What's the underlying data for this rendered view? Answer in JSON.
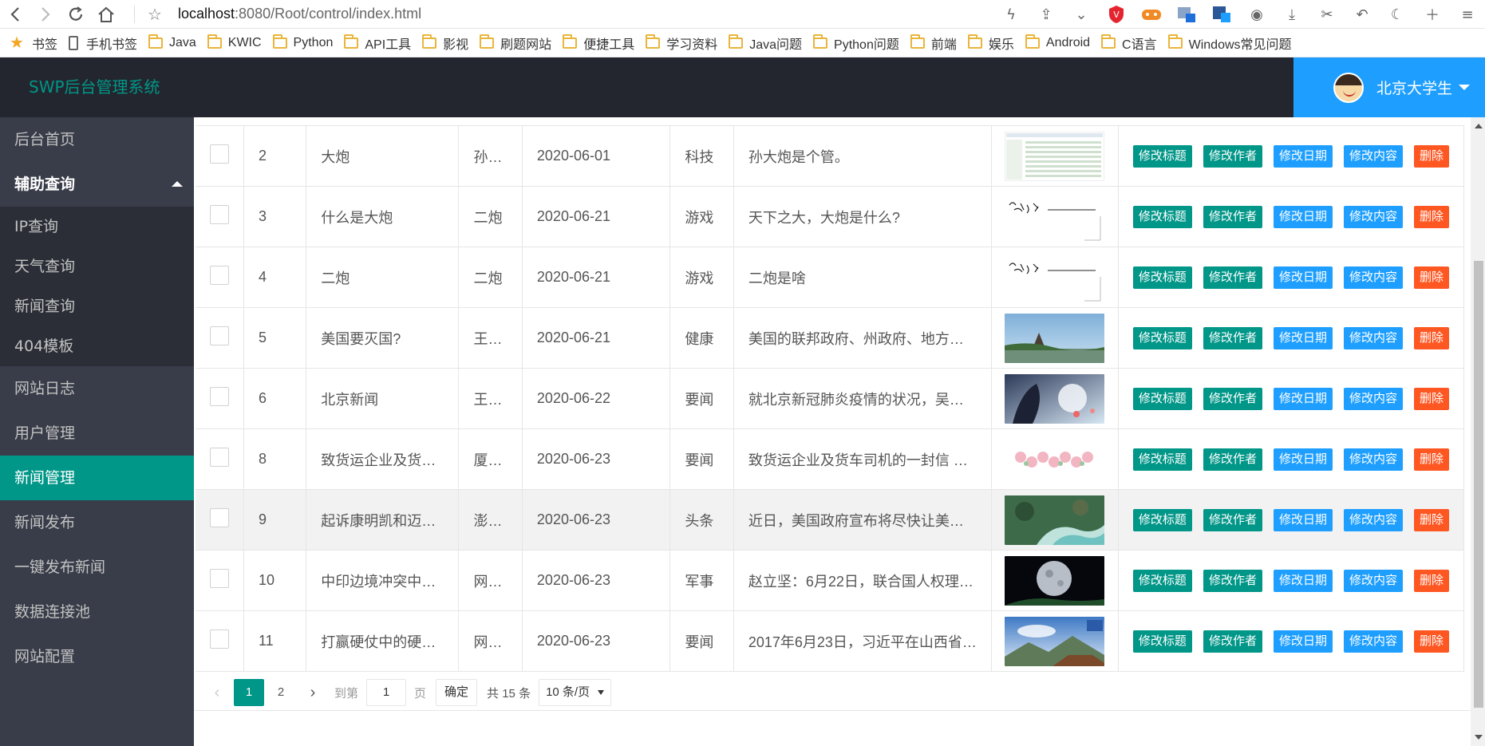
{
  "browser": {
    "url_host": "localhost",
    "url_path": ":8080/Root/control/index.html",
    "bookmarks": [
      "书签",
      "手机书签",
      "Java",
      "KWIC",
      "Python",
      "API工具",
      "影视",
      "刷题网站",
      "便捷工具",
      "学习资料",
      "Java问题",
      "Python问题",
      "前端",
      "娱乐",
      "Android",
      "C语言",
      "Windows常见问题"
    ]
  },
  "header": {
    "title": "SWP后台管理系统",
    "user_name": "北京大学生"
  },
  "sidebar": {
    "items": [
      {
        "label": "后台首页"
      },
      {
        "label": "辅助查询"
      },
      {
        "label": "IP查询"
      },
      {
        "label": "天气查询"
      },
      {
        "label": "新闻查询"
      },
      {
        "label": "404模板"
      },
      {
        "label": "网站日志"
      },
      {
        "label": "用户管理"
      },
      {
        "label": "新闻管理"
      },
      {
        "label": "新闻发布"
      },
      {
        "label": "一键发布新闻"
      },
      {
        "label": "数据连接池"
      },
      {
        "label": "网站配置"
      }
    ]
  },
  "table": {
    "actions": {
      "edit_title": "修改标题",
      "edit_author": "修改作者",
      "edit_date": "修改日期",
      "edit_content": "修改内容",
      "delete": "删除"
    },
    "rows": [
      {
        "id": "2",
        "title": "大炮",
        "author": "孙…",
        "date": "2020-06-01",
        "category": "科技",
        "content": "孙大炮是个管。",
        "thumb": "screenshot"
      },
      {
        "id": "3",
        "title": "什么是大炮",
        "author": "二炮",
        "date": "2020-06-21",
        "category": "游戏",
        "content": "天下之大，大炮是什么?",
        "thumb": "handwriting"
      },
      {
        "id": "4",
        "title": "二炮",
        "author": "二炮",
        "date": "2020-06-21",
        "category": "游戏",
        "content": "二炮是啥",
        "thumb": "handwriting"
      },
      {
        "id": "5",
        "title": "美国要灭国?",
        "author": "王…",
        "date": "2020-06-21",
        "category": "健康",
        "content": "美国的联邦政府、州政府、地方…",
        "thumb": "pavilion"
      },
      {
        "id": "6",
        "title": "北京新闻",
        "author": "王…",
        "date": "2020-06-22",
        "category": "要闻",
        "content": "就北京新冠肺炎疫情的状况，吴…",
        "thumb": "anime"
      },
      {
        "id": "8",
        "title": "致货运企业及货…",
        "author": "厦…",
        "date": "2020-06-23",
        "category": "要闻",
        "content": "致货运企业及货车司机的一封信 …",
        "thumb": "flowers"
      },
      {
        "id": "9",
        "title": "起诉康明凯和迈…",
        "author": "澎…",
        "date": "2020-06-23",
        "category": "头条",
        "content": "近日，美国政府宣布将尽快让美…",
        "thumb": "coast"
      },
      {
        "id": "10",
        "title": "中印边境冲突中…",
        "author": "网…",
        "date": "2020-06-23",
        "category": "军事",
        "content": "赵立坚：6月22日，联合国人权理…",
        "thumb": "moon"
      },
      {
        "id": "11",
        "title": "打赢硬仗中的硬…",
        "author": "网…",
        "date": "2020-06-23",
        "category": "要闻",
        "content": "2017年6月23日，习近平在山西省…",
        "thumb": "mountain"
      }
    ]
  },
  "pager": {
    "current": "1",
    "next_page": "2",
    "goto_label": "到第",
    "goto_value": "1",
    "page_label": "页",
    "confirm": "确定",
    "total": "共 15 条",
    "page_size": "10 条/页"
  },
  "colors": {
    "teal": "#009688",
    "blue": "#1e9fff",
    "red": "#ff5722",
    "dark": "#23262e",
    "sidebar": "#393d49"
  }
}
